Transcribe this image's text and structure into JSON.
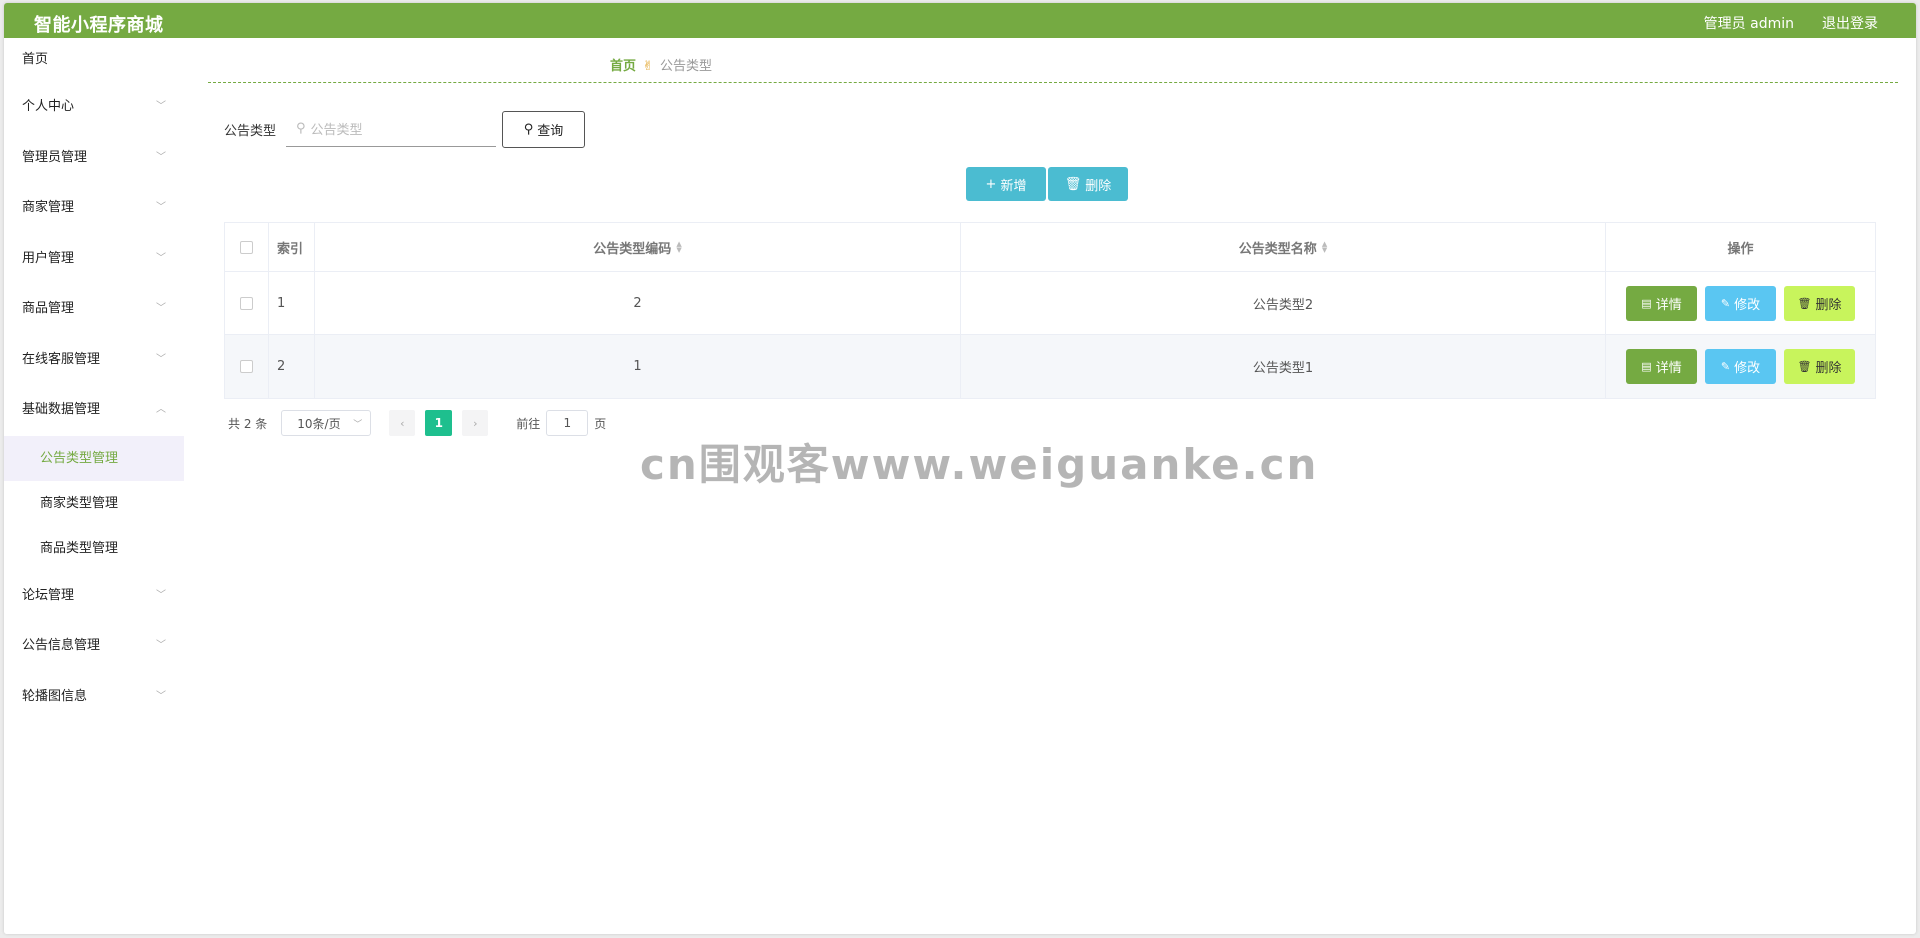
{
  "header": {
    "title": "智能小程序商城",
    "user": "管理员 admin",
    "logout": "退出登录"
  },
  "sidebar": {
    "home": "首页",
    "items": [
      {
        "label": "个人中心"
      },
      {
        "label": "管理员管理"
      },
      {
        "label": "商家管理"
      },
      {
        "label": "用户管理"
      },
      {
        "label": "商品管理"
      },
      {
        "label": "在线客服管理"
      },
      {
        "label": "基础数据管理"
      }
    ],
    "sub_items": [
      {
        "label": "公告类型管理",
        "active": true
      },
      {
        "label": "商家类型管理"
      },
      {
        "label": "商品类型管理"
      }
    ],
    "items_after": [
      {
        "label": "论坛管理"
      },
      {
        "label": "公告信息管理"
      },
      {
        "label": "轮播图信息"
      }
    ]
  },
  "breadcrumb": {
    "home": "首页",
    "separator_icon": "hand-icon",
    "current": "公告类型"
  },
  "search": {
    "label": "公告类型",
    "placeholder": "公告类型",
    "button": "查询"
  },
  "actions": {
    "add": "新增",
    "delete": "删除"
  },
  "table": {
    "headers": {
      "index": "索引",
      "code": "公告类型编码",
      "name": "公告类型名称",
      "ops": "操作"
    },
    "rows": [
      {
        "index": "1",
        "code": "2",
        "name": "公告类型2"
      },
      {
        "index": "2",
        "code": "1",
        "name": "公告类型1"
      }
    ],
    "ops": {
      "detail": "详情",
      "edit": "修改",
      "delete": "删除"
    }
  },
  "pagination": {
    "total": "共 2 条",
    "page_size": "10条/页",
    "current": "1",
    "goto_label": "前往",
    "goto_value": "1",
    "page_suffix": "页"
  },
  "watermark": "cn围观客www.weiguanke.cn",
  "colors": {
    "brand": "#75aa42",
    "action": "#4bbcd1",
    "page_active": "#1ebf8e",
    "edit": "#5ac6f2",
    "delete": "#c8f45c"
  }
}
